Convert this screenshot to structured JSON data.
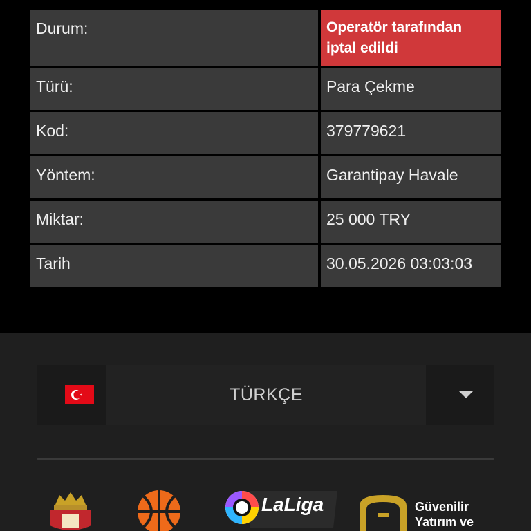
{
  "details": {
    "rows": [
      {
        "label": "Durum:",
        "value": "Operatör tarafından iptal edildi"
      },
      {
        "label": "Türü:",
        "value": "Para Çekme"
      },
      {
        "label": "Kod:",
        "value": "379779621"
      },
      {
        "label": "Yöntem:",
        "value": "Garantipay Havale"
      },
      {
        "label": "Miktar:",
        "value": "25 000 TRY"
      },
      {
        "label": "Tarih",
        "value": "30.05.2026 03:03:03"
      }
    ]
  },
  "footer": {
    "language": {
      "selected": "TÜRKÇE",
      "flag_icon": "turkey-flag-icon",
      "dropdown_icon": "caret-down-icon"
    },
    "logos": {
      "laliga_text": "LaLiga",
      "guvenilir_line1": "Güvenilir",
      "guvenilir_line2": "Yatırım ve"
    }
  },
  "colors": {
    "status_cancelled": "#d0383a",
    "cell_bg": "#3a3a3a",
    "footer_bg": "#1f1f1f"
  }
}
